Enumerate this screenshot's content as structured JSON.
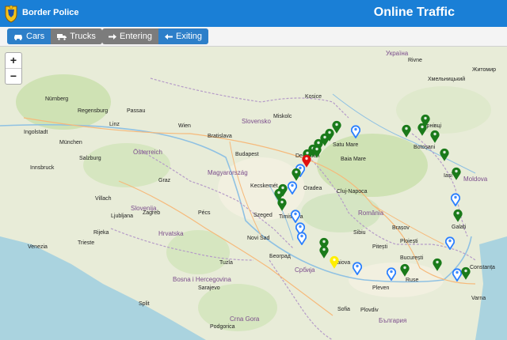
{
  "header": {
    "brand": "Border Police",
    "title": "Online Traffic"
  },
  "toolbar": {
    "vehicle": [
      {
        "label": "Cars",
        "icon": "car-icon",
        "active": true
      },
      {
        "label": "Trucks",
        "icon": "truck-icon",
        "active": false
      }
    ],
    "direction": [
      {
        "label": "Entering",
        "icon": "arrow-right-icon",
        "active": false
      },
      {
        "label": "Exiting",
        "icon": "arrow-left-icon",
        "active": true
      }
    ]
  },
  "zoom": {
    "in": "+",
    "out": "−"
  },
  "colors": {
    "header": "#1a7fd6",
    "marker_green": "#1a7a1a",
    "marker_blue": "#2a7fff",
    "marker_red": "#e01010",
    "marker_yellow": "#ffee00"
  },
  "map_labels": {
    "countries": [
      "Slovensko",
      "Magyarország",
      "Hrvatska",
      "Bosna i Hercegovina",
      "Србија",
      "Crna Gora",
      "България",
      "România",
      "Moldova",
      "Österreich",
      "Slovenija",
      "Україна"
    ],
    "cities": [
      "Nürnberg",
      "München",
      "Wien",
      "Bratislava",
      "Budapest",
      "Graz",
      "Zagreb",
      "Novi Sad",
      "Београд",
      "Timisoara",
      "Oradea",
      "Cluj-Napoca",
      "Baia Mare",
      "Satu Mare",
      "Debrecen",
      "Iași",
      "Botoșani",
      "Galați",
      "Brașov",
      "Craiova",
      "București",
      "Constanța",
      "Plovdiv",
      "Sofia",
      "Varna",
      "Miskolc",
      "Kecskemét",
      "Pécs",
      "Szeged",
      "Sibiu",
      "Pitești",
      "Ploiești",
      "Rivne",
      "Житомир",
      "Хмельницький",
      "Чернівці",
      "Ruse",
      "Pleven",
      "Kosice",
      "Rijeka",
      "Split",
      "Sarajevo",
      "Tuzla",
      "Podgorica",
      "Linz",
      "Salzburg",
      "Innsbruck",
      "Villach",
      "Ljubljana",
      "Trieste",
      "Venezia",
      "Regensburg",
      "Passau",
      "Ingolstadt"
    ]
  },
  "markers": [
    {
      "type": "green"
    },
    {
      "type": "green"
    },
    {
      "type": "green"
    },
    {
      "type": "green"
    },
    {
      "type": "green"
    },
    {
      "type": "green"
    },
    {
      "type": "green"
    },
    {
      "type": "red"
    },
    {
      "type": "blue"
    },
    {
      "type": "green"
    },
    {
      "type": "blue"
    },
    {
      "type": "green"
    },
    {
      "type": "green"
    },
    {
      "type": "green"
    },
    {
      "type": "blue"
    },
    {
      "type": "blue"
    },
    {
      "type": "blue"
    },
    {
      "type": "green"
    },
    {
      "type": "green"
    },
    {
      "type": "yellow"
    },
    {
      "type": "blue"
    },
    {
      "type": "blue"
    },
    {
      "type": "green"
    },
    {
      "type": "green"
    },
    {
      "type": "blue"
    },
    {
      "type": "green"
    },
    {
      "type": "blue"
    },
    {
      "type": "green"
    },
    {
      "type": "green"
    },
    {
      "type": "green"
    },
    {
      "type": "green"
    },
    {
      "type": "green"
    },
    {
      "type": "green"
    },
    {
      "type": "blue"
    },
    {
      "type": "green"
    },
    {
      "type": "blue"
    }
  ]
}
